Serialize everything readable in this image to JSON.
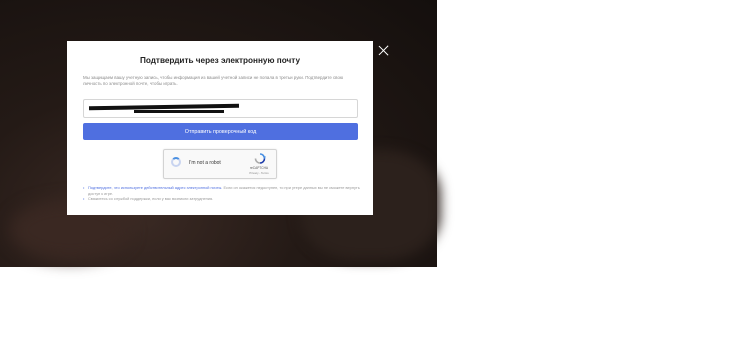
{
  "modal": {
    "title": "Подтвердить через электронную почту",
    "description": "Мы защищаем вашу учетную запись, чтобы информация из вашей учетной записи не попала в третьи руки. Подтвердите свою личность по электронной почте, чтобы играть.",
    "email_value": "",
    "send_button": "Отправить проверочный код",
    "close_label": "×"
  },
  "captcha": {
    "label": "I'm not a robot",
    "brand": "reCAPTCHA",
    "terms": "Privacy - Terms"
  },
  "notes": [
    {
      "link": "Подтвердите, что используете действительный адрес электронной почты.",
      "text": " Если он окажется недоступен, то при утере данных вы не сможете вернуть доступ к игре."
    },
    {
      "link": "",
      "text": "Свяжитесь со службой поддержки, если у вас возникли затруднения."
    }
  ],
  "colors": {
    "accent": "#4f6fe0",
    "backdrop": "#1f1713"
  }
}
